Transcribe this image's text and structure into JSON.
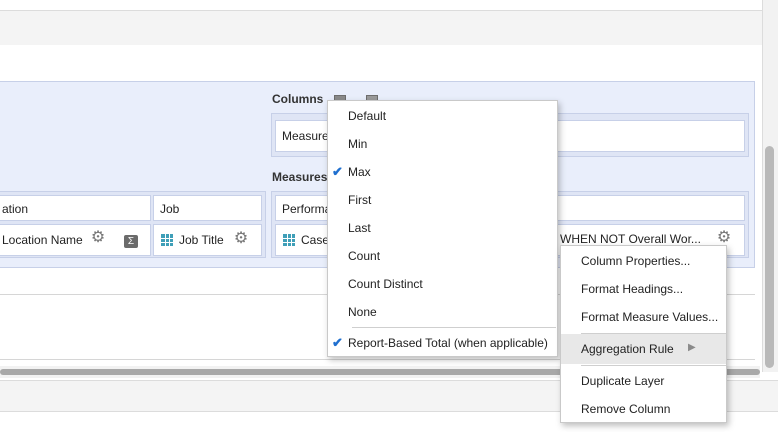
{
  "layout_panel": {
    "columns_label": "Columns",
    "columns_item": "Measure",
    "measures_label": "Measures",
    "rows_headers": [
      "ation",
      "Job"
    ],
    "rows_items": [
      "Location Name",
      "Job Title"
    ],
    "measures_header": "Performa",
    "measures_items": [
      "Case",
      "e WHEN NOT Overall Wor..."
    ]
  },
  "aggregation_menu": {
    "items": [
      {
        "label": "Default",
        "checked": false
      },
      {
        "label": "Min",
        "checked": false
      },
      {
        "label": "Max",
        "checked": true
      },
      {
        "label": "First",
        "checked": false
      },
      {
        "label": "Last",
        "checked": false
      },
      {
        "label": "Count",
        "checked": false
      },
      {
        "label": "Count Distinct",
        "checked": false
      },
      {
        "label": "None",
        "checked": false
      }
    ],
    "report_total": {
      "label": "Report-Based Total (when applicable)",
      "checked": true
    }
  },
  "column_menu": {
    "column_properties": "Column Properties...",
    "format_headings": "Format Headings...",
    "format_measure_values": "Format Measure Values...",
    "aggregation_rule": "Aggregation Rule",
    "duplicate_layer": "Duplicate Layer",
    "remove_column": "Remove Column"
  },
  "icons": {
    "gear": "gear-icon",
    "sigma": "sigma-icon",
    "grid": "grid-icon",
    "check": "check-icon",
    "submenu": "submenu-arrow-icon"
  },
  "colors": {
    "panel_bg": "#e9eefb",
    "check": "#1f6fcf",
    "grid_icon": "#3f9fb8"
  }
}
